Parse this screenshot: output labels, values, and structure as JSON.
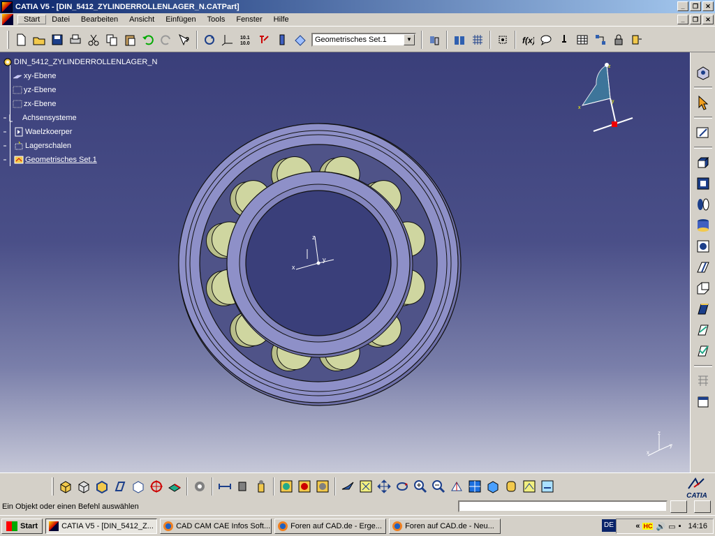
{
  "window": {
    "title": "CATIA V5 - [DIN_5412_ZYLINDERROLLENLAGER_N.CATPart]"
  },
  "menu": [
    "Start",
    "Datei",
    "Bearbeiten",
    "Ansicht",
    "Einfügen",
    "Tools",
    "Fenster",
    "Hilfe"
  ],
  "toolbar": {
    "geometric_set_select": "Geometrisches Set.1"
  },
  "tree": {
    "root": "DIN_5412_ZYLINDERROLLENLAGER_N",
    "items": [
      "xy-Ebene",
      "yz-Ebene",
      "zx-Ebene",
      "Achsensysteme",
      "Waelzkoerper",
      "Lagerschalen",
      "Geometrisches Set.1"
    ]
  },
  "axes": {
    "x": "x",
    "y": "y",
    "z": "z"
  },
  "status": {
    "message": "Ein Objekt oder einen Befehl auswählen"
  },
  "logo": {
    "text": "CATIA"
  },
  "taskbar": {
    "start": "Start",
    "tasks": [
      "CATIA V5 - [DIN_5412_Z...",
      "CAD CAM CAE Infos Soft...",
      "Foren auf CAD.de - Erge...",
      "Foren auf CAD.de - Neu..."
    ],
    "language": "DE",
    "tray_hc": "HC",
    "clock": "14:16"
  },
  "colors": {
    "roller": "#cfd6a0",
    "ring": "#8e90c8",
    "background_top": "#3a3f7a"
  }
}
